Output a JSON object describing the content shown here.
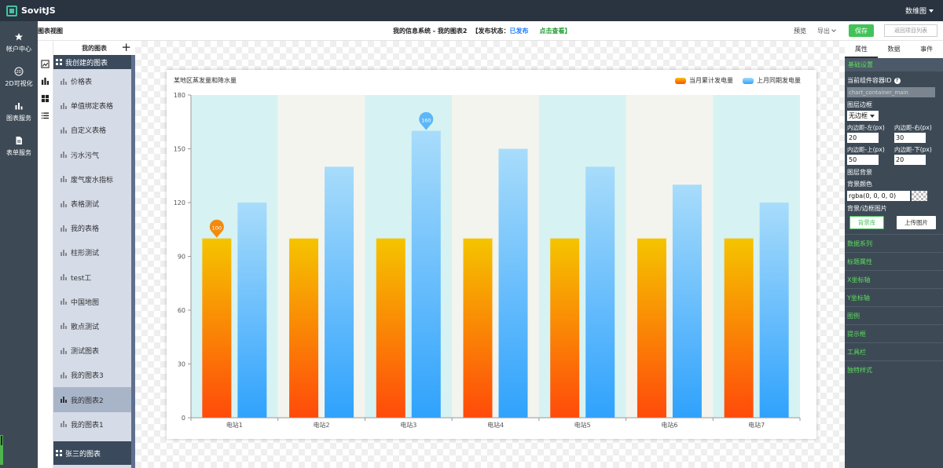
{
  "app": {
    "name": "SovitJS",
    "user_menu": "数维图"
  },
  "nav": [
    {
      "label": "帐户中心",
      "icon": "star-icon"
    },
    {
      "label": "2D可视化",
      "icon": "2d-icon"
    },
    {
      "label": "图表服务",
      "icon": "bar-chart-icon"
    },
    {
      "label": "表单服务",
      "icon": "form-icon"
    }
  ],
  "header": {
    "view_title": "图表视图",
    "system_chart": "我的信息系统 - 我的图表2",
    "status_prefix": "【发布状态：",
    "status_value": "已发布",
    "view_link": "点击查看】",
    "preview": "预览",
    "export": "导出",
    "save": "保存",
    "back": "返回项目列表"
  },
  "list": {
    "title": "我的图表",
    "group_mine": "我创建的图表",
    "items": [
      "价格表",
      "单值绑定表格",
      "自定义表格",
      "污水污气",
      "废气废水指标",
      "表格测试",
      "我的表格",
      "柱形测试",
      "test工",
      "中国地图",
      "散点测试",
      "测试图表",
      "我的图表3",
      "我的图表2",
      "我的图表1"
    ],
    "active_item": "我的图表2",
    "group_other": "张三的图表"
  },
  "chart_data": {
    "type": "bar",
    "title": "某地区蒸发量和降水量",
    "categories": [
      "电站1",
      "电站2",
      "电站3",
      "电站4",
      "电站5",
      "电站6",
      "电站7"
    ],
    "series": [
      {
        "name": "当月累计发电量",
        "values": [
          100,
          100,
          100,
          100,
          100,
          100,
          100
        ],
        "color_top": "#f5c400",
        "color_bottom": "#ff4a0a"
      },
      {
        "name": "上月同期发电量",
        "values": [
          120,
          140,
          160,
          150,
          140,
          130,
          120
        ],
        "color_top": "#a8dcfb",
        "color_bottom": "#2fa2fc"
      }
    ],
    "markers": [
      {
        "series": 0,
        "category": "电站1",
        "label": "100",
        "color": "#f28a10"
      },
      {
        "series": 1,
        "category": "电站3",
        "label": "160",
        "color": "#5bb7f8"
      }
    ],
    "ylim": [
      0,
      180
    ],
    "yticks": [
      0,
      30,
      60,
      90,
      120,
      150,
      180
    ],
    "xlabel": "",
    "ylabel": "",
    "legend_position": "top-right",
    "split_area_colors": [
      "#d7f2f2",
      "#f3f4ee"
    ]
  },
  "props": {
    "tabs": [
      "属性",
      "数据",
      "事件"
    ],
    "active_tab": "属性",
    "section_basic": "基础设置",
    "container_id_label": "当前组件容器ID",
    "container_id": "chart_container_main",
    "border_label": "图层边框",
    "border_value": "无边框",
    "pad_left_label": "内边距-左(px)",
    "pad_left": "20",
    "pad_right_label": "内边距-右(px)",
    "pad_right": "30",
    "pad_top_label": "内边距-上(px)",
    "pad_top": "50",
    "pad_bottom_label": "内边距-下(px)",
    "pad_bottom": "20",
    "bg_section": "图层背景",
    "bg_color_label": "背景颜色",
    "bg_color": "rgba(0, 0, 0, 0)",
    "bg_image_label": "背景/边框图片",
    "bg_library": "背景库",
    "upload_image": "上传图片",
    "sections": [
      "数据系列",
      "标题属性",
      "X坐标轴",
      "Y坐标轴",
      "图例",
      "提示框",
      "工具栏",
      "独特样式"
    ]
  }
}
